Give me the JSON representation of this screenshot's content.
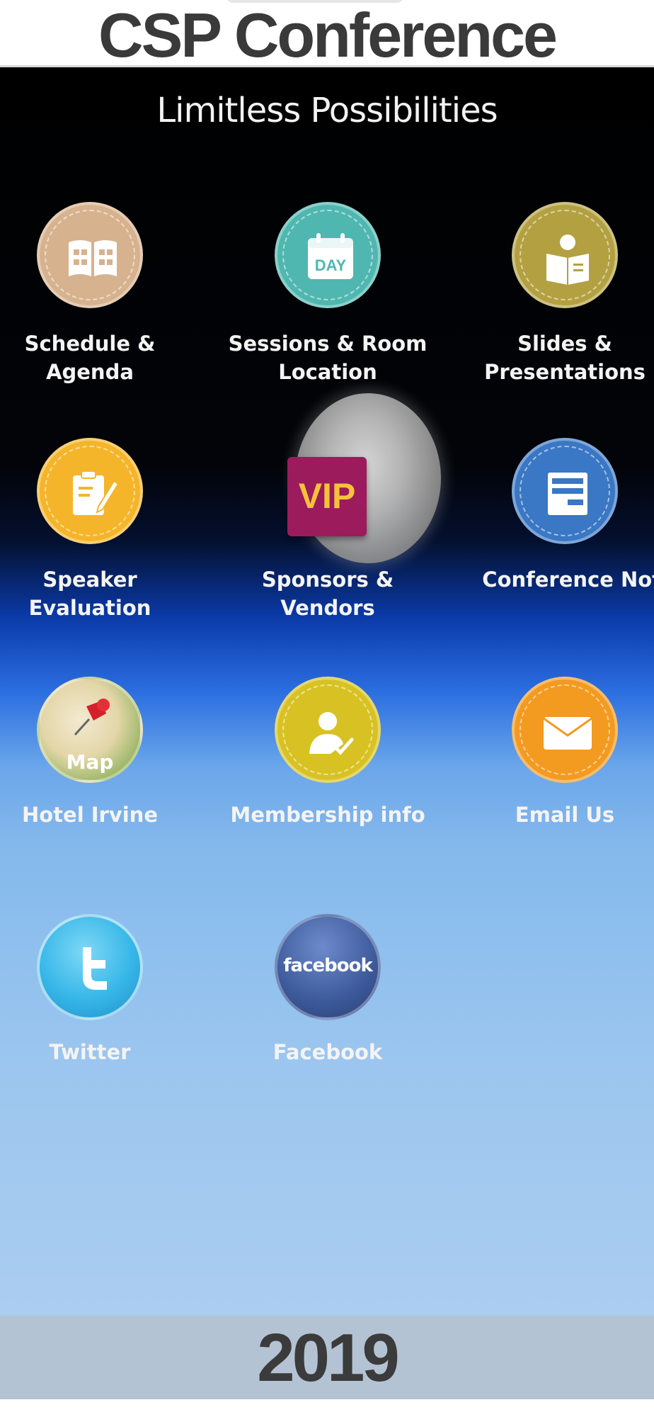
{
  "header": {
    "title": "CSP Conference"
  },
  "subtitle": "Limitless Possibilities",
  "tiles": [
    {
      "label_line1": "Schedule &",
      "label_line2": "Agenda",
      "icon": "book-icon",
      "color": "#d7b28e"
    },
    {
      "label_line1": "Sessions & Room",
      "label_line2": "Location",
      "icon": "calendar-day-icon",
      "icon_text": "DAY",
      "color": "#4fb7b0"
    },
    {
      "label_line1": "Slides &",
      "label_line2": "Presentations",
      "icon": "reading-person-icon",
      "color": "#b3a041"
    },
    {
      "label_line1": "Speaker",
      "label_line2": "Evaluation",
      "icon": "clipboard-pen-icon",
      "color": "#f5b52a"
    },
    {
      "label_line1": "Sponsors &",
      "label_line2": "Vendors",
      "icon": "vip-badge-icon",
      "icon_text": "VIP",
      "color": "#9b1b5c"
    },
    {
      "label_line1": "Conference Note",
      "label_line2": "",
      "icon": "notes-icon",
      "color": "#3a77c4"
    },
    {
      "label_line1": "Hotel Irvine",
      "label_line2": "",
      "icon": "map-pin-icon",
      "icon_text": "Map",
      "color": "#8bb35a"
    },
    {
      "label_line1": "Membership info",
      "label_line2": "",
      "icon": "member-icon",
      "color": "#d8c223"
    },
    {
      "label_line1": "Email Us",
      "label_line2": "",
      "icon": "envelope-icon",
      "color": "#f39a20"
    },
    {
      "label_line1": "Twitter",
      "label_line2": "",
      "icon": "twitter-icon",
      "color": "#37b7e8"
    },
    {
      "label_line1": "Facebook",
      "label_line2": "",
      "icon": "facebook-icon",
      "icon_text": "facebook",
      "color": "#3d5a9b"
    }
  ],
  "footer": {
    "year": "2019"
  }
}
